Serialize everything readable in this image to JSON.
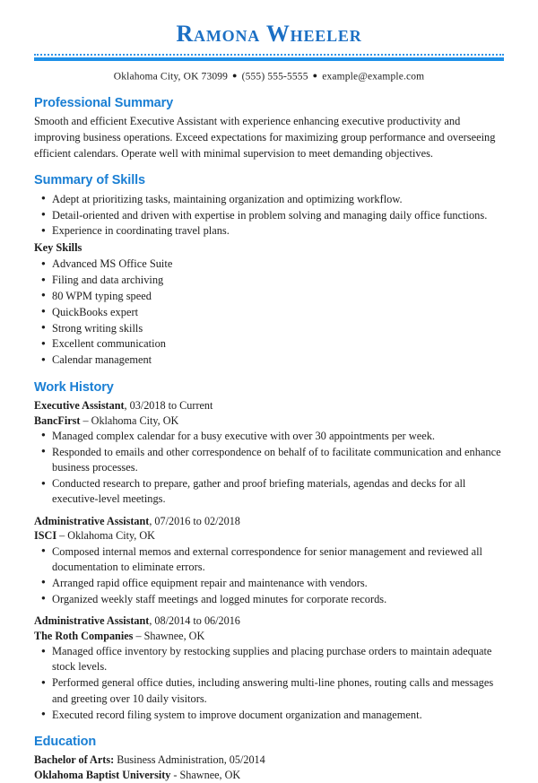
{
  "header": {
    "name": "Ramona Wheeler",
    "contact": {
      "location": "Oklahoma City, OK 73099",
      "phone": "(555) 555-5555",
      "email": "example@example.com",
      "separator": "●"
    },
    "accent_color": "#1e90e8",
    "name_color": "#1b6fc4",
    "heading_color": "#1a7fd4"
  },
  "sections": {
    "professional_summary": {
      "title": "Professional Summary",
      "body": "Smooth and efficient Executive Assistant with experience enhancing executive productivity and improving business operations. Exceed expectations for maximizing group performance and overseeing efficient calendars. Operate well with minimal supervision to meet demanding objectives."
    },
    "summary_of_skills": {
      "title": "Summary of Skills",
      "bullets": [
        "Adept at prioritizing tasks, maintaining organization and optimizing workflow.",
        "Detail-oriented and driven with expertise in problem solving and managing daily office functions.",
        "Experience in coordinating travel plans."
      ],
      "key_skills_label": "Key Skills",
      "key_skills": [
        "Advanced MS Office Suite",
        "Filing and data archiving",
        "80 WPM typing speed",
        "QuickBooks expert",
        "Strong writing skills",
        "Excellent communication",
        "Calendar management"
      ]
    },
    "work_history": {
      "title": "Work History",
      "jobs": [
        {
          "title": "Executive Assistant",
          "dates": ", 03/2018 to Current",
          "company": "BancFirst",
          "location": " – Oklahoma City, OK",
          "bullets": [
            "Managed complex calendar for a busy executive with over 30 appointments per week.",
            "Responded to emails and other correspondence on behalf of to facilitate communication and enhance business processes.",
            "Conducted research to prepare, gather and proof briefing materials, agendas and decks for all executive-level meetings."
          ]
        },
        {
          "title": "Administrative Assistant",
          "dates": ", 07/2016 to 02/2018",
          "company": "ISCI",
          "location": " – Oklahoma City, OK",
          "bullets": [
            "Composed internal memos and external correspondence for senior management and reviewed all documentation to eliminate errors.",
            "Arranged rapid office equipment repair and maintenance with vendors.",
            "Organized weekly staff meetings and logged minutes for corporate records."
          ]
        },
        {
          "title": "Administrative Assistant",
          "dates": ", 08/2014 to 06/2016",
          "company": "The Roth Companies",
          "location": " – Shawnee, OK",
          "bullets": [
            "Managed office inventory by restocking supplies and placing purchase orders to maintain adequate stock levels.",
            "Performed general office duties, including answering multi-line phones, routing calls and messages and greeting over 10 daily visitors.",
            "Executed record filing system to improve document organization and management."
          ]
        }
      ]
    },
    "education": {
      "title": "Education",
      "degree_label": "Bachelor of Arts:",
      "degree_detail": " Business Administration, 05/2014",
      "school": "Oklahoma Baptist University",
      "school_location": " - Shawnee, OK"
    }
  }
}
